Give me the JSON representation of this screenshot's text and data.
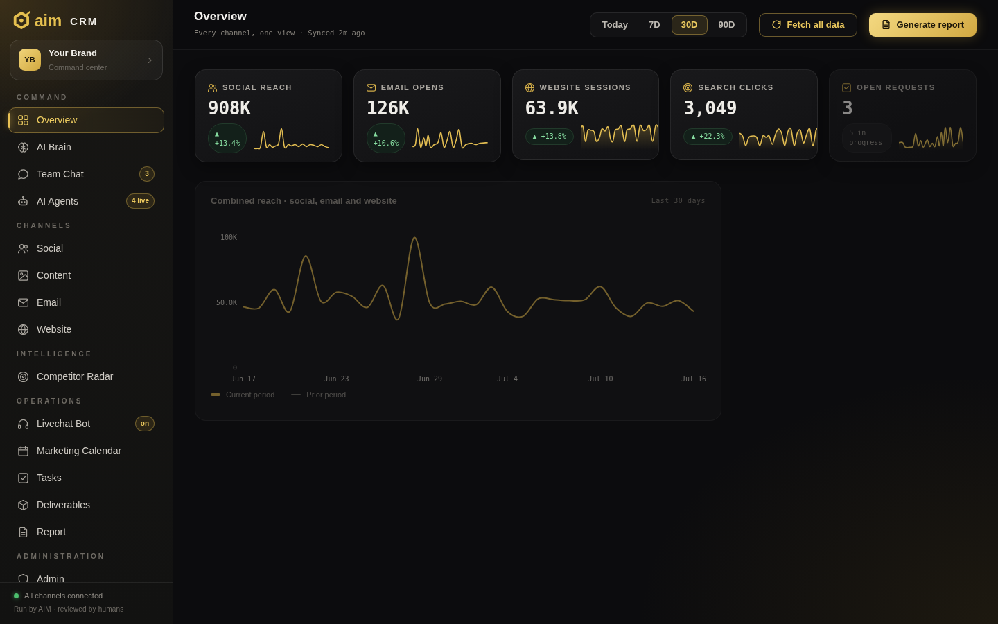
{
  "sidebar": {
    "logo": {
      "brand": "aim",
      "product": "CRM"
    },
    "workspace": {
      "avatar": "YB",
      "name": "Your Brand",
      "subtitle": "Command center"
    },
    "sections": [
      {
        "label": "COMMAND",
        "items": [
          {
            "label": "Overview",
            "selected": true
          },
          {
            "label": "AI Brain",
            "selected": false
          },
          {
            "label": "Team Chat",
            "selected": false,
            "badge": "3"
          },
          {
            "label": "AI Agents",
            "selected": false,
            "badge": "4 live"
          }
        ]
      },
      {
        "label": "CHANNELS",
        "items": [
          {
            "label": "Social",
            "selected": false
          },
          {
            "label": "Content",
            "selected": false
          },
          {
            "label": "Email",
            "selected": false
          },
          {
            "label": "Website",
            "selected": false
          }
        ]
      },
      {
        "label": "INTELLIGENCE",
        "items": [
          {
            "label": "Competitor Radar",
            "selected": false
          }
        ]
      },
      {
        "label": "OPERATIONS",
        "items": [
          {
            "label": "Livechat Bot",
            "selected": false,
            "badge": "on"
          },
          {
            "label": "Marketing Calendar",
            "selected": false
          },
          {
            "label": "Tasks",
            "selected": false
          },
          {
            "label": "Deliverables",
            "selected": false
          },
          {
            "label": "Report",
            "selected": false
          }
        ]
      },
      {
        "label": "ADMINISTRATION",
        "items": [
          {
            "label": "Admin",
            "selected": false
          }
        ]
      }
    ],
    "footer": {
      "status": "All channels connected",
      "online": true,
      "note": "Run by AIM · reviewed by humans"
    }
  },
  "header": {
    "title": "Overview",
    "subtitle": "Every channel, one view · Synced 2m ago",
    "ranges": [
      {
        "label": "Today",
        "selected": false
      },
      {
        "label": "7D",
        "selected": false
      },
      {
        "label": "30D",
        "selected": true
      },
      {
        "label": "90D",
        "selected": false
      }
    ],
    "buttons": [
      {
        "label": "Fetch all data",
        "kind": "outline"
      },
      {
        "label": "Generate report",
        "kind": "primary"
      }
    ]
  },
  "kpis": [
    {
      "label": "SOCIAL REACH",
      "value": "908K",
      "delta": "▲ +13.4%",
      "kind": "stacked",
      "faded": false
    },
    {
      "label": "EMAIL OPENS",
      "value": "126K",
      "delta": "▲ +10.6%",
      "kind": "stacked",
      "faded": false
    },
    {
      "label": "WEBSITE SESSIONS",
      "value": "63.9K",
      "delta": "▲ +13.8%",
      "kind": "inline",
      "faded": false
    },
    {
      "label": "SEARCH CLICKS",
      "value": "3,049",
      "delta": "▲ +22.3%",
      "kind": "inline",
      "faded": false
    },
    {
      "label": "OPEN REQUESTS",
      "value": "3",
      "note": "5 in progress",
      "kind": "count",
      "faded": true
    }
  ],
  "reach_panel": {
    "title": "Combined reach · social, email and website",
    "range": "Last 30 days",
    "faded": true,
    "prior_label": "Prior period",
    "chart_data": {
      "type": "line",
      "categories": [
        "Jun 17",
        null,
        null,
        null,
        null,
        null,
        "Jun 23",
        null,
        null,
        null,
        null,
        null,
        "Jun 29",
        null,
        null,
        null,
        null,
        "Jul 4",
        null,
        null,
        null,
        null,
        null,
        "Jul 10",
        null,
        null,
        null,
        null,
        null,
        "Jul 16"
      ],
      "ylim": [
        0,
        100
      ],
      "yticks": [
        {
          "value": 0,
          "label": "0"
        },
        {
          "value": 50,
          "label": "50.0K"
        },
        {
          "value": 100,
          "label": "100K"
        }
      ],
      "series": [
        {
          "name": "Current period",
          "color": "#c9a646",
          "values": [
            46.6,
            45.6,
            59.8,
            43,
            85.6,
            50.8,
            57.7,
            54.6,
            46.1,
            62.9,
            37.4,
            99.7,
            49.5,
            48.7,
            50.8,
            48.2,
            61.6,
            43,
            39.2,
            52.8,
            52,
            51.3,
            52,
            62.1,
            45.6,
            39.2,
            49.5,
            46.9,
            51.3,
            43
          ]
        }
      ]
    }
  }
}
